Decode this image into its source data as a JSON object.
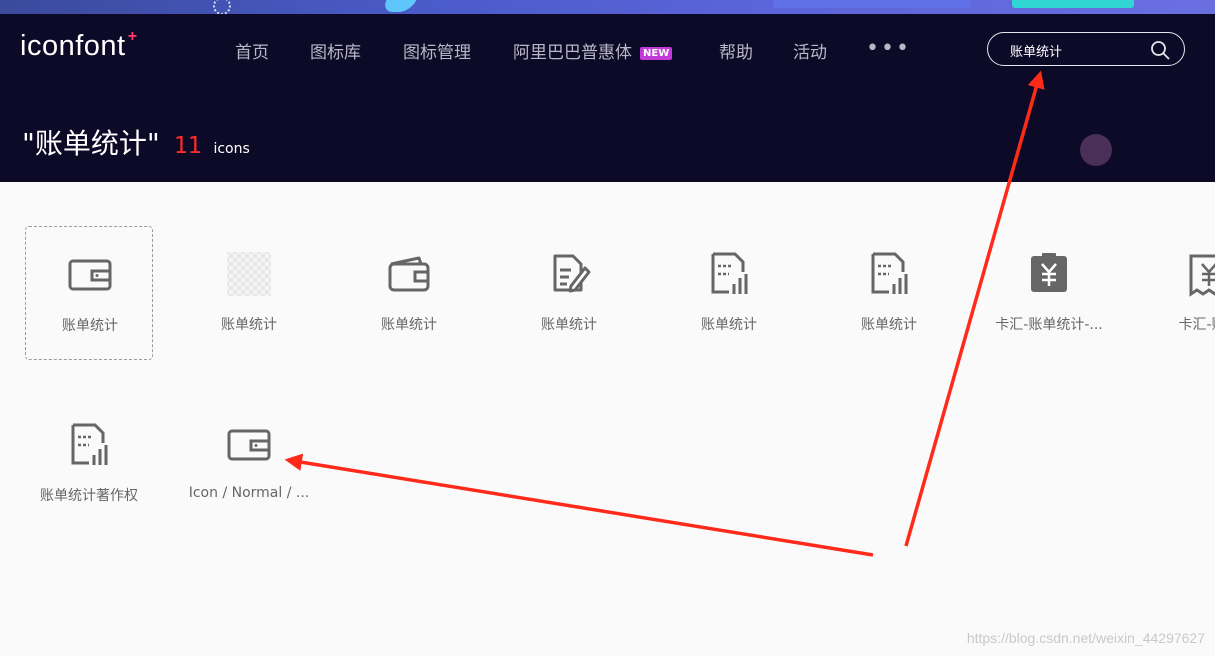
{
  "banner": {
    "colors": {
      "start": "#3b4a9c",
      "end": "#6a6fe0"
    }
  },
  "nav": {
    "logo": "iconfont",
    "items": [
      {
        "label": "首页"
      },
      {
        "label": "图标库"
      },
      {
        "label": "图标管理"
      },
      {
        "label": "阿里巴巴普惠体",
        "badge": "NEW"
      },
      {
        "label": "帮助"
      },
      {
        "label": "活动"
      }
    ],
    "more": "•••",
    "search": {
      "value": "账单统计",
      "icon": "search-icon"
    }
  },
  "result": {
    "query": "\"账单统计\"",
    "count": "11",
    "unit": "icons"
  },
  "icons": [
    {
      "label": "账单统计",
      "icon": "wallet-icon",
      "selected": true
    },
    {
      "label": "账单统计",
      "icon": "placeholder-transparent-icon"
    },
    {
      "label": "账单统计",
      "icon": "wallet-icon"
    },
    {
      "label": "账单统计",
      "icon": "document-edit-icon"
    },
    {
      "label": "账单统计",
      "icon": "document-chart-icon"
    },
    {
      "label": "账单统计",
      "icon": "document-chart-icon"
    },
    {
      "label": "卡汇-账单统计-...",
      "icon": "yuan-bag-icon"
    },
    {
      "label": "卡汇-账单",
      "icon": "yuan-receipt-icon"
    },
    {
      "label": "账单统计著作权",
      "icon": "document-chart-icon"
    },
    {
      "label": "Icon / Normal / ...",
      "icon": "wallet-icon"
    }
  ],
  "annotations": {
    "arrow_color": "#ff2a1a"
  },
  "watermark": "https://blog.csdn.net/weixin_44297627",
  "colors": {
    "header_bg": "#0c0a26",
    "accent_red": "#ff2b2b",
    "new_badge": "#c23ad7",
    "icon_gray": "#666666"
  }
}
